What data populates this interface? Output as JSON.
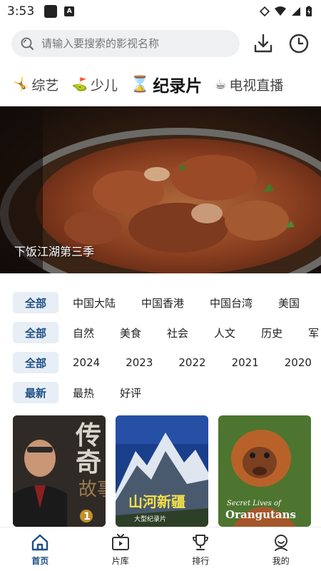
{
  "status_bar": {
    "time": "3:53",
    "a_label": "A"
  },
  "search": {
    "placeholder": "请输入要搜索的影视名称"
  },
  "category_tabs": [
    {
      "emoji": "🤸",
      "label": "综艺"
    },
    {
      "emoji": "⛳",
      "label": "少儿"
    },
    {
      "emoji": "⌛",
      "label": "纪录片"
    },
    {
      "emoji": "☕",
      "label": "电视直播"
    }
  ],
  "banner": {
    "caption": "下饭江湖第三季"
  },
  "filters": {
    "region": {
      "selected": "全部",
      "options": [
        "中国大陆",
        "中国香港",
        "中国台湾",
        "美国"
      ]
    },
    "genre": {
      "selected": "全部",
      "options": [
        "自然",
        "美食",
        "社会",
        "人文",
        "历史",
        "军"
      ]
    },
    "year": {
      "selected": "全部",
      "options": [
        "2024",
        "2023",
        "2022",
        "2021",
        "2020"
      ]
    },
    "sort": {
      "selected": "最新",
      "options": [
        "最热",
        "好评"
      ]
    }
  },
  "posters": [
    {
      "title": "传奇故事",
      "number": "1"
    },
    {
      "title": "山河新疆",
      "subtitle": "大型纪录片"
    },
    {
      "title": "Secret Lives of Orangutans"
    }
  ],
  "bottom_nav": [
    {
      "label": "首页",
      "icon": "home-icon",
      "active": true
    },
    {
      "label": "片库",
      "icon": "tv-icon",
      "active": false
    },
    {
      "label": "排行",
      "icon": "trophy-icon",
      "active": false
    },
    {
      "label": "我的",
      "icon": "profile-icon",
      "active": false
    }
  ],
  "colors": {
    "accent": "#1d4f86",
    "chip_bg": "#e7eef5",
    "search_bg": "#eef0f2"
  }
}
